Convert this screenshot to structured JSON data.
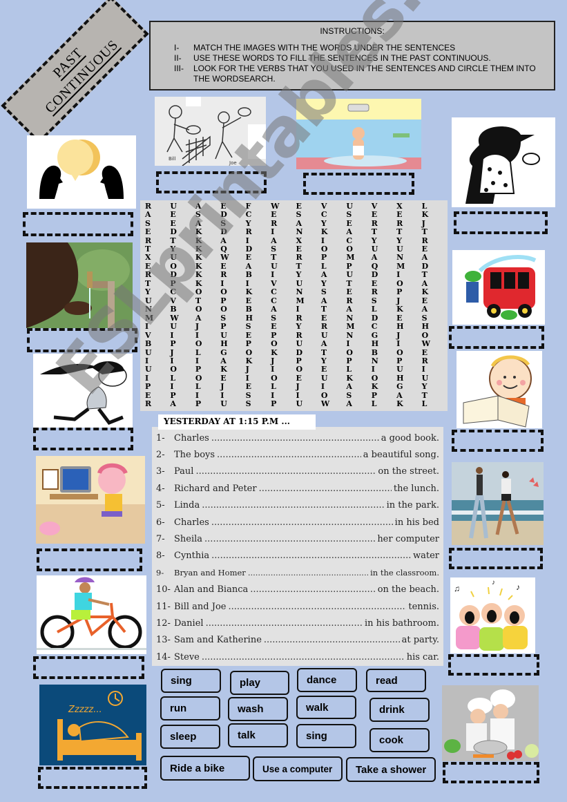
{
  "title": {
    "line1": "PAST",
    "line2": "CONTINUOUS"
  },
  "instructions": {
    "heading": "INSTRUCTIONS:",
    "items": [
      {
        "num": "I-",
        "text": "MATCH THE IMAGES WITH THE WORDS UNDER THE SENTENCES"
      },
      {
        "num": "II-",
        "text": "USE THESE WORDS TO FILL THE SENTENCES IN THE PAST CONTINUOUS."
      },
      {
        "num": "III-",
        "text": "LOOK FOR THE VERBS THAT YOU USED IN THE SENTENCES AND CIRCLE THEM INTO THE WORDSEARCH."
      }
    ]
  },
  "pictures": [
    {
      "id": "talk",
      "label": "two people talking with speech bubbles"
    },
    {
      "id": "tennis",
      "label": "Bill and Joe playing tennis",
      "caption_left": "Bill",
      "caption_right": "Joe"
    },
    {
      "id": "shower",
      "label": "man taking a shower"
    },
    {
      "id": "dance",
      "label": "couple dancing"
    },
    {
      "id": "drink",
      "label": "child drinking water from a tap"
    },
    {
      "id": "wash",
      "label": "boy washing a red car"
    },
    {
      "id": "run",
      "label": "girl running"
    },
    {
      "id": "read",
      "label": "child reading a book"
    },
    {
      "id": "computer",
      "label": "girl using a computer"
    },
    {
      "id": "walk",
      "label": "couple walking on the beach"
    },
    {
      "id": "bike",
      "label": "boy riding a bike"
    },
    {
      "id": "sing",
      "label": "kids singing"
    },
    {
      "id": "sleep",
      "label": "person sleeping in bed",
      "zzz": "Zzzzz..."
    },
    {
      "id": "cook",
      "label": "children cooking"
    }
  ],
  "wordsearch": {
    "rows": [
      "RUAEFWEVUVXL",
      "AESDCESCSEEK",
      "SEASYRAYERRJ",
      "EDKDRINKATTT",
      "RTKAIAXICYYR",
      "TYKQDSEOOUUE",
      "XUKWETRPMANA",
      "EOKEAUTLPQMD",
      "RDKRBIYAUDIT",
      "TPKIIVUYTEOA",
      "YCOOKCNSERPK",
      "UVTPECMARSJE",
      "NBOOBAITALKA",
      "MWASHSRENDES",
      "IUJPSEYRMCHH",
      "VIIUEPRUNGJO",
      "BPOHPOUAIHIW",
      "UJLGOKDTOBOE",
      "IIIAKJPYPNPR",
      "UOPKJIOELIUI",
      "ILOEIOEUKOHU",
      "PILJELJIAKGY",
      "EPIISIIOSPAT",
      "RAPUSPUWALKL"
    ]
  },
  "sentences": {
    "heading": "YESTERDAY AT 1:15 P.M ...",
    "items": [
      {
        "num": "1-",
        "subject": "Charles",
        "ending": "a good book."
      },
      {
        "num": "2-",
        "subject": "The boys",
        "ending": "a beautiful song."
      },
      {
        "num": "3-",
        "subject": "Paul",
        "ending": "on the street."
      },
      {
        "num": "4-",
        "subject": "Richard and Peter",
        "ending": "the lunch."
      },
      {
        "num": "5-",
        "subject": "Linda",
        "ending": "in the park."
      },
      {
        "num": "6-",
        "subject": "Charles",
        "ending": "in his bed"
      },
      {
        "num": "7-",
        "subject": "Sheila",
        "ending": "her computer"
      },
      {
        "num": "8-",
        "subject": "Cynthia",
        "ending": "water"
      },
      {
        "num": "9-",
        "subject": "Bryan and Homer",
        "ending": "in the classroom."
      },
      {
        "num": "10-",
        "subject": "Alan and Bianca",
        "ending": "on the beach."
      },
      {
        "num": "11-",
        "subject": "Bill and Joe",
        "ending": "tennis."
      },
      {
        "num": "12-",
        "subject": "Daniel",
        "ending": "in his bathroom."
      },
      {
        "num": "13-",
        "subject": "Sam and Katherine",
        "ending": "at party."
      },
      {
        "num": "14-",
        "subject": "Steve",
        "ending": "his car."
      }
    ],
    "dots": "...................................................................................................................."
  },
  "word_bank": [
    "sing",
    "play",
    "dance",
    "read",
    "run",
    "wash",
    "walk",
    "drink",
    "sleep",
    "talk",
    "sing",
    "cook",
    "Ride a bike",
    "Use a computer",
    "Take a shower"
  ],
  "watermark": "ESLprintables.com",
  "colors": {
    "page_bg": "#b4c6e7",
    "panel_gray": "#dcdcdc",
    "title_gray": "#b7b4b0"
  }
}
